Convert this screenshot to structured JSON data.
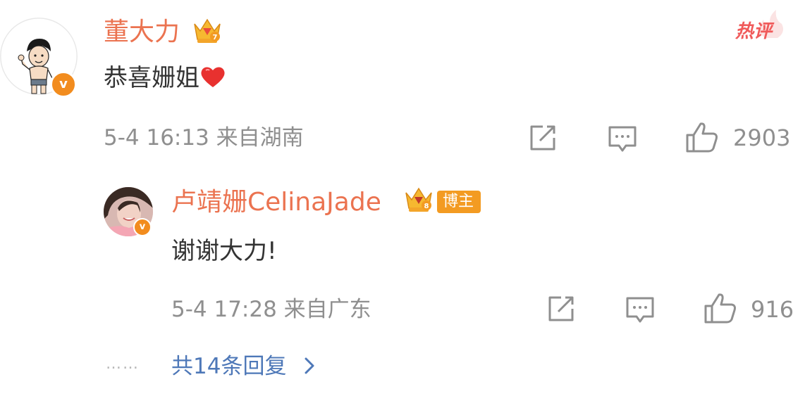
{
  "comment": {
    "username": "董大力",
    "level_badge": "crown-level-7-icon",
    "text": "恭喜姗姐",
    "emoji": "heart-icon",
    "hot_label": "热评",
    "meta": "5-4 16:13 来自湖南",
    "likes": "2903",
    "verified_color": "#f28c1e",
    "name_color": "#eb7350"
  },
  "reply": {
    "username": "卢靖姗CelinaJade",
    "level_badge": "crown-level-8-icon",
    "host_label": "博主",
    "text": "谢谢大力!",
    "meta": "5-4 17:28 来自广东",
    "likes": "916"
  },
  "more_replies": {
    "dots": "……",
    "label": "共14条回复",
    "chevron": "chevron-right-icon"
  }
}
